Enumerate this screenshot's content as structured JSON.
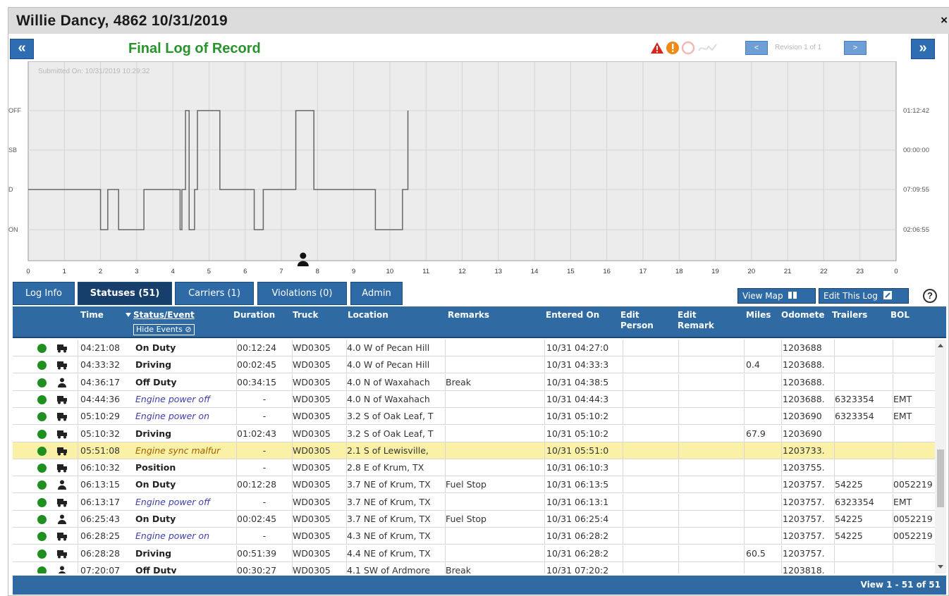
{
  "window": {
    "title": "Willie Dancy, 4862  10/31/2019",
    "close_label": "×"
  },
  "nav": {
    "prev_label": "«",
    "next_label": "»"
  },
  "log_title": "Final Log of Record",
  "status_icons": [
    "violation-warning-icon",
    "exclamation-icon",
    "certify-icon",
    "signature-icon"
  ],
  "revision": {
    "prev_label": "<",
    "next_label": ">",
    "text": "Revision 1 of 1"
  },
  "graph": {
    "submitted": "Submitted On: 10/31/2019 10:29:32",
    "status_labels": [
      "OFF",
      "SB",
      "D",
      "ON"
    ],
    "totals": [
      "01:12:42",
      "00:00:00",
      "07:09:55",
      "02:06:55"
    ],
    "hours": [
      "0",
      "1",
      "2",
      "3",
      "4",
      "5",
      "6",
      "7",
      "8",
      "9",
      "10",
      "11",
      "12",
      "13",
      "14",
      "15",
      "16",
      "17",
      "18",
      "19",
      "20",
      "21",
      "22",
      "23",
      "0"
    ],
    "segments": [
      {
        "status": "D",
        "from": 0.0,
        "to": 2.0
      },
      {
        "status": "ON",
        "from": 2.0,
        "to": 2.2
      },
      {
        "status": "D",
        "from": 2.2,
        "to": 2.5
      },
      {
        "status": "ON",
        "from": 2.5,
        "to": 3.2
      },
      {
        "status": "D",
        "from": 3.2,
        "to": 4.2
      },
      {
        "status": "ON",
        "from": 4.2,
        "to": 4.25
      },
      {
        "status": "D",
        "from": 4.25,
        "to": 4.35
      },
      {
        "status": "OFF",
        "from": 4.35,
        "to": 4.45
      },
      {
        "status": "ON",
        "from": 4.45,
        "to": 4.6
      },
      {
        "status": "D",
        "from": 4.6,
        "to": 4.68
      },
      {
        "status": "OFF",
        "from": 4.68,
        "to": 5.3
      },
      {
        "status": "D",
        "from": 5.3,
        "to": 6.25
      },
      {
        "status": "ON",
        "from": 6.25,
        "to": 6.5
      },
      {
        "status": "D",
        "from": 6.5,
        "to": 7.4
      },
      {
        "status": "OFF",
        "from": 7.4,
        "to": 7.9
      },
      {
        "status": "D",
        "from": 7.9,
        "to": 9.6
      },
      {
        "status": "ON",
        "from": 9.6,
        "to": 10.35
      },
      {
        "status": "D",
        "from": 10.35,
        "to": 10.5
      },
      {
        "status": "OFF",
        "from": 10.5,
        "to": 10.5
      }
    ],
    "driver_marker_hour": 7.6
  },
  "tabs": [
    {
      "label": "Log Info",
      "active": false
    },
    {
      "label": "Statuses (51)",
      "active": true
    },
    {
      "label": "Carriers (1)",
      "active": false
    },
    {
      "label": "Violations (0)",
      "active": false
    },
    {
      "label": "Admin",
      "active": false
    }
  ],
  "actions": {
    "view_map": "View Map",
    "edit_log": "Edit This Log",
    "help": "?"
  },
  "columns": {
    "time": "Time",
    "status": "Status/Event",
    "hide_events": "Hide Events",
    "duration": "Duration",
    "truck": "Truck",
    "location": "Location",
    "remarks": "Remarks",
    "entered": "Entered On",
    "edit_person": "Edit Person",
    "edit_remark": "Edit Remark",
    "miles": "Miles",
    "odometer": "Odomete",
    "trailers": "Trailers",
    "bol": "BOL"
  },
  "rows": [
    {
      "kind": "truck",
      "time": "04:21:08",
      "status": "On Duty",
      "style": "bold",
      "duration": "00:12:24",
      "truck": "WD0305",
      "location": "4.0 W of Pecan Hill",
      "remarks": "",
      "entered": "10/31 04:27:0",
      "miles": "",
      "odometer": "1203688",
      "trailers": "",
      "bol": ""
    },
    {
      "kind": "truck",
      "time": "04:33:32",
      "status": "Driving",
      "style": "bold",
      "duration": "00:02:45",
      "truck": "WD0305",
      "location": "4.0 W of Pecan Hill",
      "remarks": "",
      "entered": "10/31 04:33:3",
      "miles": "0.4",
      "odometer": "1203688.",
      "trailers": "",
      "bol": ""
    },
    {
      "kind": "person",
      "time": "04:36:17",
      "status": "Off Duty",
      "style": "bold",
      "duration": "00:34:15",
      "truck": "WD0305",
      "location": "4.0 N of Waxahach",
      "remarks": "Break",
      "entered": "10/31 04:38:5",
      "miles": "",
      "odometer": "1203688.",
      "trailers": "",
      "bol": ""
    },
    {
      "kind": "truck",
      "time": "04:44:36",
      "status": "Engine power off",
      "style": "ital",
      "duration": "-",
      "truck": "WD0305",
      "location": "4.0 N of Waxahach",
      "remarks": "",
      "entered": "10/31 04:44:3",
      "miles": "",
      "odometer": "1203688.",
      "trailers": "6323354",
      "bol": "EMT"
    },
    {
      "kind": "truck",
      "time": "05:10:29",
      "status": "Engine power on",
      "style": "ital",
      "duration": "-",
      "truck": "WD0305",
      "location": "3.2 S of Oak Leaf, T",
      "remarks": "",
      "entered": "10/31 05:10:2",
      "miles": "",
      "odometer": "1203690",
      "trailers": "6323354",
      "bol": "EMT"
    },
    {
      "kind": "truck",
      "time": "05:10:32",
      "status": "Driving",
      "style": "bold",
      "duration": "01:02:43",
      "truck": "WD0305",
      "location": "3.2 S of Oak Leaf, T",
      "remarks": "",
      "entered": "10/31 05:10:2",
      "miles": "67.9",
      "odometer": "1203690",
      "trailers": "",
      "bol": ""
    },
    {
      "kind": "truck",
      "time": "05:51:08",
      "status": "Engine sync malfur",
      "style": "warn",
      "duration": "-",
      "truck": "WD0305",
      "location": "2.1 S of Lewisville,",
      "remarks": "",
      "entered": "10/31 05:51:0",
      "miles": "",
      "odometer": "1203733.",
      "trailers": "",
      "bol": "",
      "highlight": true
    },
    {
      "kind": "truck",
      "time": "06:10:32",
      "status": "Position",
      "style": "bold",
      "duration": "-",
      "truck": "WD0305",
      "location": "2.8 E of Krum, TX",
      "remarks": "",
      "entered": "10/31 06:10:3",
      "miles": "",
      "odometer": "1203755.",
      "trailers": "",
      "bol": ""
    },
    {
      "kind": "person",
      "time": "06:13:15",
      "status": "On Duty",
      "style": "bold",
      "duration": "00:12:28",
      "truck": "WD0305",
      "location": "3.7 NE of Krum, TX",
      "remarks": "Fuel Stop",
      "entered": "10/31 06:13:5",
      "miles": "",
      "odometer": "1203757.",
      "trailers": "54225",
      "bol": "0052219"
    },
    {
      "kind": "truck",
      "time": "06:13:17",
      "status": "Engine power off",
      "style": "ital",
      "duration": "-",
      "truck": "WD0305",
      "location": "3.7 NE of Krum, TX",
      "remarks": "",
      "entered": "10/31 06:13:1",
      "miles": "",
      "odometer": "1203757.",
      "trailers": "6323354",
      "bol": "EMT"
    },
    {
      "kind": "person",
      "time": "06:25:43",
      "status": "On Duty",
      "style": "bold",
      "duration": "00:02:45",
      "truck": "WD0305",
      "location": "3.7 NE of Krum, TX",
      "remarks": "Fuel Stop",
      "entered": "10/31 06:25:4",
      "miles": "",
      "odometer": "1203757.",
      "trailers": "54225",
      "bol": "0052219"
    },
    {
      "kind": "truck",
      "time": "06:28:25",
      "status": "Engine power on",
      "style": "ital",
      "duration": "-",
      "truck": "WD0305",
      "location": "4.3 NE of Krum, TX",
      "remarks": "",
      "entered": "10/31 06:28:2",
      "miles": "",
      "odometer": "1203757.",
      "trailers": "54225",
      "bol": "0052219"
    },
    {
      "kind": "truck",
      "time": "06:28:28",
      "status": "Driving",
      "style": "bold",
      "duration": "00:51:39",
      "truck": "WD0305",
      "location": "4.4 NE of Krum, TX",
      "remarks": "",
      "entered": "10/31 06:28:2",
      "miles": "60.5",
      "odometer": "1203757.",
      "trailers": "",
      "bol": ""
    },
    {
      "kind": "person",
      "time": "07:20:07",
      "status": "Off Duty",
      "style": "bold",
      "duration": "00:30:27",
      "truck": "WD0305",
      "location": "4.1 SW of Ardmore",
      "remarks": "Break",
      "entered": "10/31 07:20:2",
      "miles": "",
      "odometer": "1203818.",
      "trailers": "",
      "bol": ""
    }
  ],
  "pager": "View 1 - 51 of 51",
  "colors": {
    "header_blue": "#2f6aa3",
    "title_green": "#27942b",
    "highlight": "#fbf1a6",
    "status_green": "#1f8f1f"
  }
}
